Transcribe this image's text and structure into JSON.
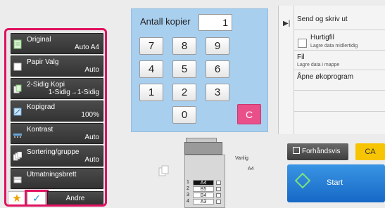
{
  "left_panel": {
    "functions": [
      {
        "label": "Original",
        "value": "Auto  A4",
        "icon": "original-icon"
      },
      {
        "label": "Papir Valg",
        "value": "Auto",
        "icon": "paper-select-icon"
      },
      {
        "label": "2-Sidig Kopi",
        "value": "1-Sidig→1-Sidig",
        "icon": "duplex-icon"
      },
      {
        "label": "Kopigrad",
        "value": "100%",
        "icon": "ratio-icon"
      },
      {
        "label": "Kontrast",
        "value": "Auto",
        "icon": "exposure-icon"
      },
      {
        "label": "Sortering/gruppe",
        "value": "Auto",
        "icon": "sort-icon"
      },
      {
        "label": "Utmatningsbrett",
        "value": "",
        "icon": "output-tray-icon"
      }
    ],
    "bottom": {
      "star": "★",
      "check": "✓",
      "other_label": "Andre"
    }
  },
  "keypad": {
    "title": "Antall kopier",
    "display_value": "1",
    "keys": [
      "7",
      "8",
      "9",
      "4",
      "5",
      "6",
      "1",
      "2",
      "3",
      "0"
    ],
    "clear_label": "C"
  },
  "right_panel": {
    "send_print": "Send og skriv ut",
    "quick_file": "Hurtigfil",
    "quick_file_sub": "Lagre data midlertidig",
    "file": "Fil",
    "file_sub": "Lagre data i mappe",
    "eco": "Åpne økoprogram"
  },
  "preview_label": "Forhåndsvis",
  "ca_label": "CA",
  "start_label": "Start",
  "machine": {
    "paper_type": "Vanlig",
    "paper_size": "A4",
    "trays": [
      {
        "num": "1",
        "size": "A4",
        "selected": true
      },
      {
        "num": "2",
        "size": "B5",
        "selected": false
      },
      {
        "num": "3",
        "size": "B4",
        "selected": false
      },
      {
        "num": "4",
        "size": "A3",
        "selected": false
      }
    ]
  },
  "colors": {
    "highlight": "#e0115f",
    "keypad_bg": "#a9cfef",
    "start": "#1d7ad6",
    "clear": "#e95089",
    "ca": "#f6c400"
  }
}
